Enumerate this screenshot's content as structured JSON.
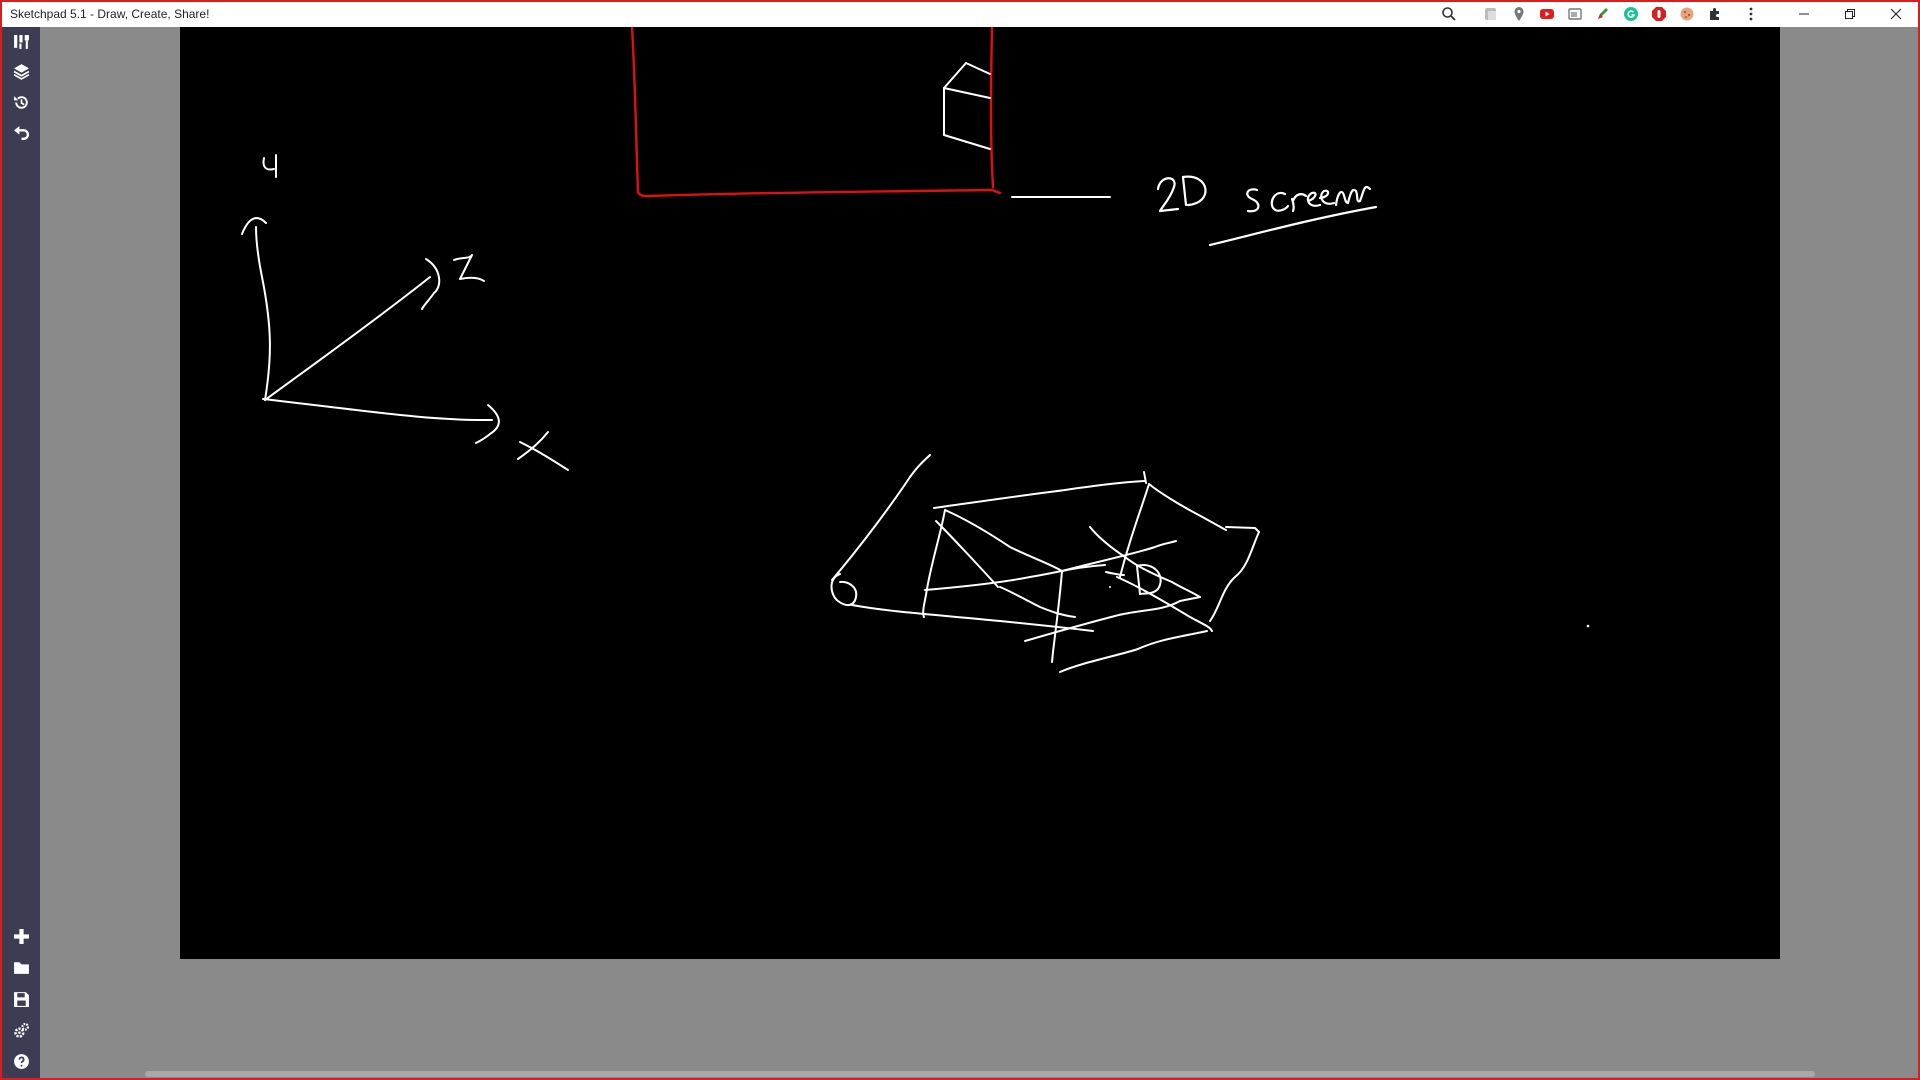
{
  "window": {
    "title": "Sketchpad 5.1 - Draw, Create, Share!"
  },
  "extensions": [
    {
      "icon": "zoom-icon"
    },
    {
      "icon": "gray-flag-icon"
    },
    {
      "icon": "map-pin-icon"
    },
    {
      "icon": "youtube-icon"
    },
    {
      "icon": "screenshot-icon"
    },
    {
      "icon": "pen-check-icon"
    },
    {
      "icon": "grammarly-icon"
    },
    {
      "icon": "stop-hand-icon"
    },
    {
      "icon": "cookie-icon"
    },
    {
      "icon": "puzzle-extensions-icon"
    },
    {
      "icon": "kebab-menu-icon"
    }
  ],
  "window_controls": [
    "minimize",
    "restore",
    "close"
  ],
  "sidebar": {
    "top_tools": [
      "brush-tools-icon",
      "layers-icon",
      "history-icon",
      "undo-icon"
    ],
    "bottom_tools": [
      "new-icon",
      "open-folder-icon",
      "save-icon",
      "settings-icon",
      "help-icon"
    ]
  },
  "canvas": {
    "background": "#000000",
    "stroke_color": "#ffffff",
    "accent_stroke_color": "#e01010",
    "handwritten_label": "2D screen",
    "axis_labels": [
      "y",
      "z",
      "x"
    ]
  },
  "colors": {
    "window_border": "#d81e1e",
    "sidebar": "#3d3c52",
    "workspace": "#8a8a8a"
  }
}
